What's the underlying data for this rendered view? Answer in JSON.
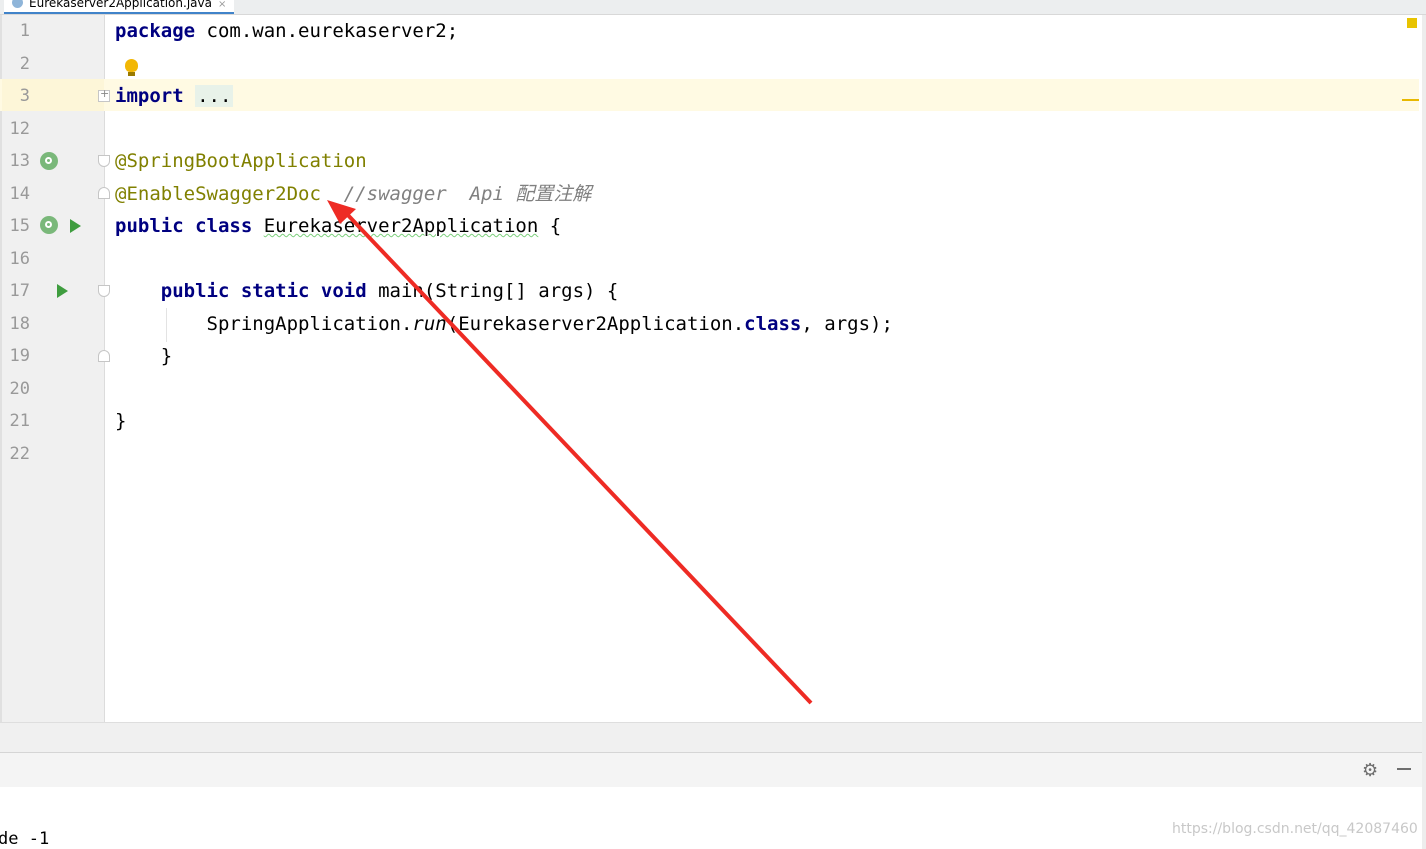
{
  "tab": {
    "title": "Eurekaserver2Application.java",
    "close": "×"
  },
  "gutter": {
    "lines": [
      "1",
      "2",
      "3",
      "12",
      "13",
      "14",
      "15",
      "16",
      "17",
      "18",
      "19",
      "20",
      "21",
      "22"
    ]
  },
  "code": {
    "l1_kw": "package",
    "l1_rest": " com.wan.eurekaserver2;",
    "l3_kw": "import",
    "l3_dots": "...",
    "l13_ann": "@SpringBootApplication",
    "l14_ann": "@EnableSwagger2Doc",
    "l14_cmt": "  //swagger  Api 配置注解",
    "l15_kw": "public class",
    "l15_name": "Eurekaserver2Application",
    "l15_rest": " {",
    "l17_kw": "public static void",
    "l17_rest": " main(String[] args) {",
    "l18_a": "SpringApplication.",
    "l18_run": "run",
    "l18_b": "(Eurekaserver2Application.",
    "l18_kw": "class",
    "l18_c": ", args);",
    "l19": "}",
    "l21": "}"
  },
  "bottom_panel": {
    "output_text": "de -1",
    "gear": "⚙"
  },
  "watermark": "https://blog.csdn.net/qq_42087460",
  "colors": {
    "keyword": "#000080",
    "annotation": "#808000",
    "comment": "#808080",
    "arrow": "#ee2b24",
    "run": "#3f9d3f"
  }
}
